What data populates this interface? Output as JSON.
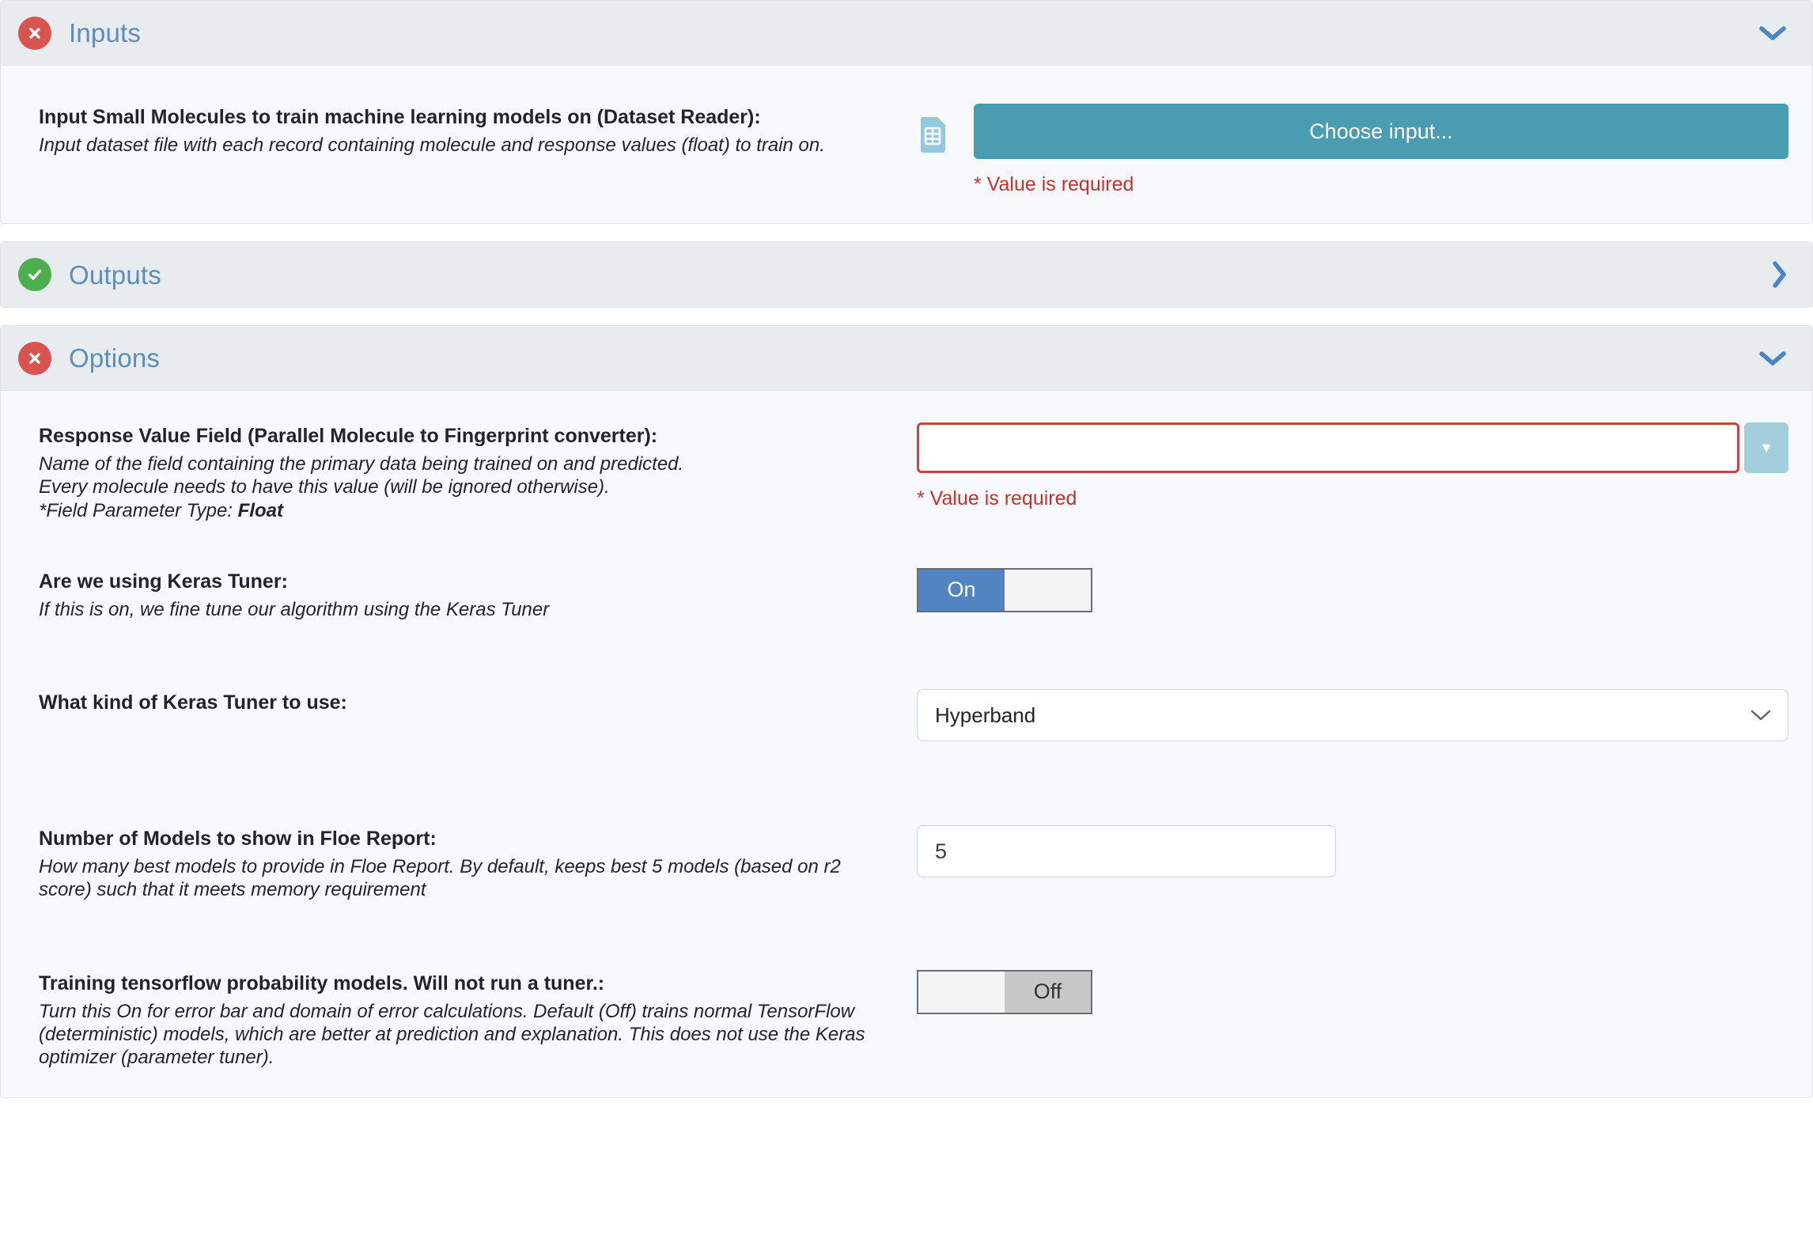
{
  "sections": [
    {
      "id": "inputs",
      "title": "Inputs",
      "status_icon": "error-circle-icon",
      "chevron_icon": "chevron-down-icon",
      "expanded": true
    },
    {
      "id": "outputs",
      "title": "Outputs",
      "status_icon": "check-circle-icon",
      "chevron_icon": "chevron-right-icon",
      "expanded": false
    },
    {
      "id": "options",
      "title": "Options",
      "status_icon": "error-circle-icon",
      "chevron_icon": "chevron-down-icon",
      "expanded": true
    }
  ],
  "inputs": {
    "dataset_field": {
      "label": "Input Small Molecules to train machine learning models on (Dataset Reader):",
      "description": "Input dataset file with each record containing molecule and response values (float) to train on.",
      "icon": "dataset-table-icon",
      "button_label": "Choose input...",
      "error": "* Value is required"
    }
  },
  "options": {
    "response_value_field": {
      "label": "Response Value Field (Parallel Molecule to Fingerprint converter):",
      "description_line1": "Name of the field containing the primary data being trained on and predicted.",
      "description_line2": "Every molecule needs to have this value (will be ignored otherwise).",
      "description_line3_prefix": "*Field Parameter Type: ",
      "description_line3_value": "Float",
      "value": "",
      "placeholder": "",
      "error": "* Value is required",
      "dropdown_icon": "caret-down-icon"
    },
    "keras_tuner_toggle": {
      "label": "Are we using Keras Tuner:",
      "description": "If this is on, we fine tune our algorithm using the Keras Tuner",
      "state": "On",
      "on_label": "On",
      "off_label": ""
    },
    "keras_tuner_kind": {
      "label": "What kind of Keras Tuner to use:",
      "selected": "Hyperband",
      "options": [
        "Hyperband"
      ],
      "caret_icon": "chevron-down-icon"
    },
    "number_of_models": {
      "label": "Number of Models to show in Floe Report:",
      "description": "How many best models to provide in Floe Report. By default, keeps best 5 models (based on r2 score) such that it meets memory requirement",
      "value": "5"
    },
    "tensorflow_probability_toggle": {
      "label": "Training tensorflow probability models. Will not run a tuner.:",
      "description": "Turn this On for error bar and domain of error calculations. Default (Off) trains normal TensorFlow (deterministic) models, which are better at prediction and explanation. This does not use the Keras optimizer (parameter tuner).",
      "state": "Off",
      "on_label": "",
      "off_label": "Off"
    }
  },
  "colors": {
    "accent_button": "#4a9cb0",
    "title_blue": "#5b8cc4",
    "error_red": "#c9302c",
    "status_error": "#d9534f",
    "status_ok": "#4cae4c",
    "toggle_on_blue": "#5384c2",
    "toggle_off_gray": "#c8c8c8",
    "header_bg": "#e9ecef",
    "panel_bg": "#f8f9fb"
  }
}
